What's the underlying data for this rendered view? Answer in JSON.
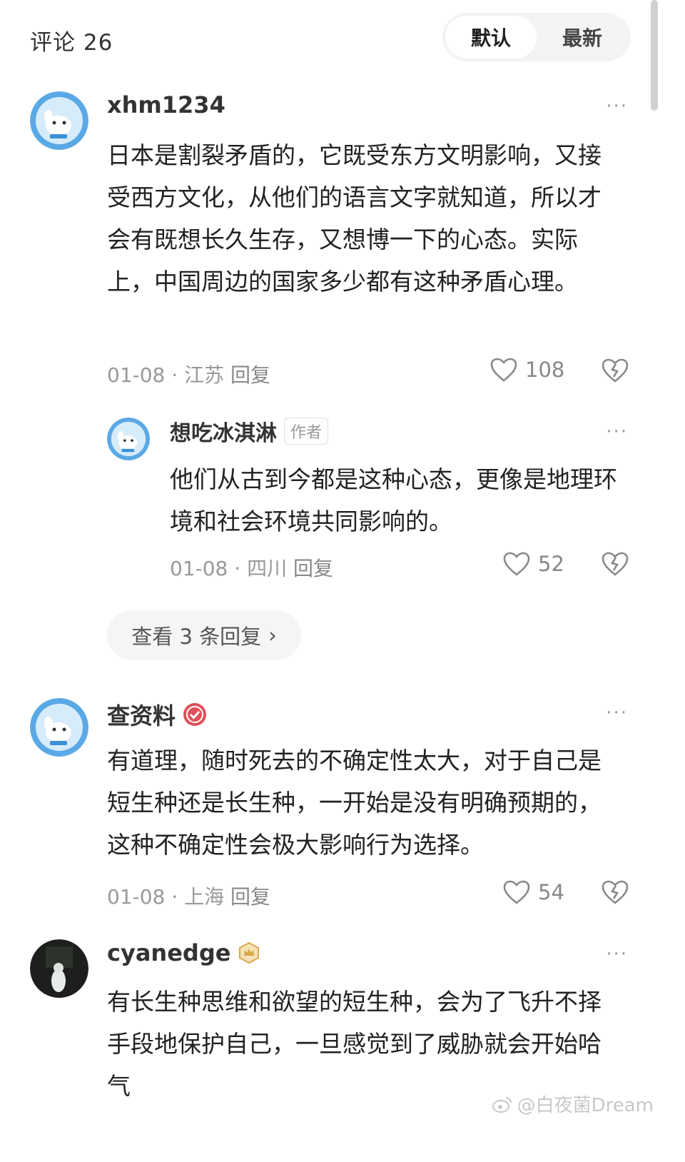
{
  "header": {
    "title": "评论 26"
  },
  "sort_tabs": {
    "default_label": "默认",
    "latest_label": "最新",
    "selected": "默认"
  },
  "more_label": "···",
  "comments": [
    {
      "username": "xhm1234",
      "avatar": "cartoon-dog-icon",
      "text": "日本是割裂矛盾的，它既受东方文明影响，又接受西方文化，从他们的语言文字就知道，所以才会有既想长久生存，又想博一下的心态。实际上，中国周边的国家多少都有这种矛盾心理。",
      "date_location": "01-08 · 江苏",
      "reply_label": "回复",
      "likes": "108",
      "reply": {
        "username": "想吃冰淇淋",
        "badge": "作者",
        "avatar": "cartoon-dog-icon",
        "text": "他们从古到今都是这种心态，更像是地理环境和社会环境共同影响的。",
        "date_location": "01-08 · 四川",
        "reply_label": "回复",
        "likes": "52"
      },
      "view_replies_label": "查看 3 条回复",
      "view_replies_chevron": "›"
    },
    {
      "username": "查资料",
      "badge_icon": "verified-icon",
      "avatar": "cartoon-dog-icon",
      "text": "有道理，随时死去的不确定性太大，对于自己是短生种还是长生种，一开始是没有明确预期的，这种不确定性会极大影响行为选择。",
      "date_location": "01-08 · 上海",
      "reply_label": "回复",
      "likes": "54"
    },
    {
      "username": "cyanedge",
      "badge_icon": "crown-icon",
      "avatar": "dark-photo-avatar",
      "text": "有长生种思维和欲望的短生种，会为了飞升不择手段地保护自己，一旦感觉到了威胁就会开始哈气"
    }
  ],
  "watermark": "@白夜菌Dream",
  "colors": {
    "text": "#222222",
    "meta": "#999999",
    "pill_bg": "#f3f3f4",
    "avatar_blue": "#5aa9e6"
  }
}
